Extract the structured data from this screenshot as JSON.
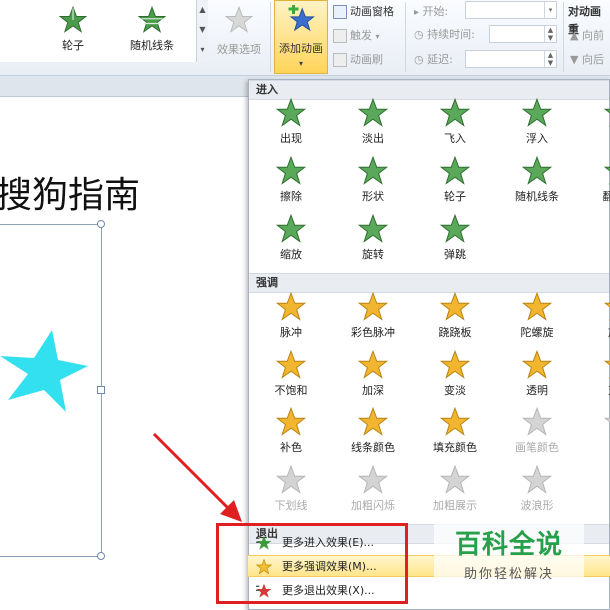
{
  "ribbon": {
    "gallery_items": [
      {
        "label": "轮子",
        "icon": "star-wheel-icon"
      },
      {
        "label": "随机线条",
        "icon": "star-lines-icon"
      }
    ],
    "effect_options": "效果选项",
    "add_animation": "添加动画",
    "animation_pane": "动画窗格",
    "trigger": "触发",
    "animation_painter": "动画刷",
    "start_label": "开始:",
    "duration_label": "持续时间:",
    "delay_label": "延迟:",
    "reorder_title": "对动画重",
    "move_earlier": "向前",
    "move_later": "向后"
  },
  "slide": {
    "title_text": "搜狗指南",
    "star_color": "#33e0f0"
  },
  "panel": {
    "entrance_header": "进入",
    "entrance_effects": [
      "出现",
      "淡出",
      "飞入",
      "浮入",
      "弹",
      "擦除",
      "形状",
      "轮子",
      "随机线条",
      "翻转式",
      "缩放",
      "旋转",
      "弹跳"
    ],
    "emphasis_header": "强调",
    "emphasis_effects": [
      "脉冲",
      "彩色脉冲",
      "跷跷板",
      "陀螺旋",
      "放大",
      "不饱和",
      "加深",
      "变淡",
      "透明",
      "对象",
      "补色",
      "线条颜色",
      "填充颜色",
      "画笔颜色",
      "字",
      "下划线",
      "加粗闪烁",
      "加粗展示",
      "波浪形"
    ],
    "exit_header": "退出"
  },
  "more_menu": [
    {
      "label": "更多进入效果(E)...",
      "icon": "entrance-star-icon"
    },
    {
      "label": "更多强调效果(M)...",
      "icon": "emphasis-star-icon"
    },
    {
      "label": "更多退出效果(X)...",
      "icon": "exit-star-icon"
    }
  ],
  "watermark": {
    "title": "百科全说",
    "subtitle": "助你轻松解决"
  },
  "colors": {
    "entrance_green": "#5aa85a",
    "emphasis_gold": "#f2b530",
    "highlight_red": "#e02020",
    "watermark_green": "#26a04a"
  }
}
